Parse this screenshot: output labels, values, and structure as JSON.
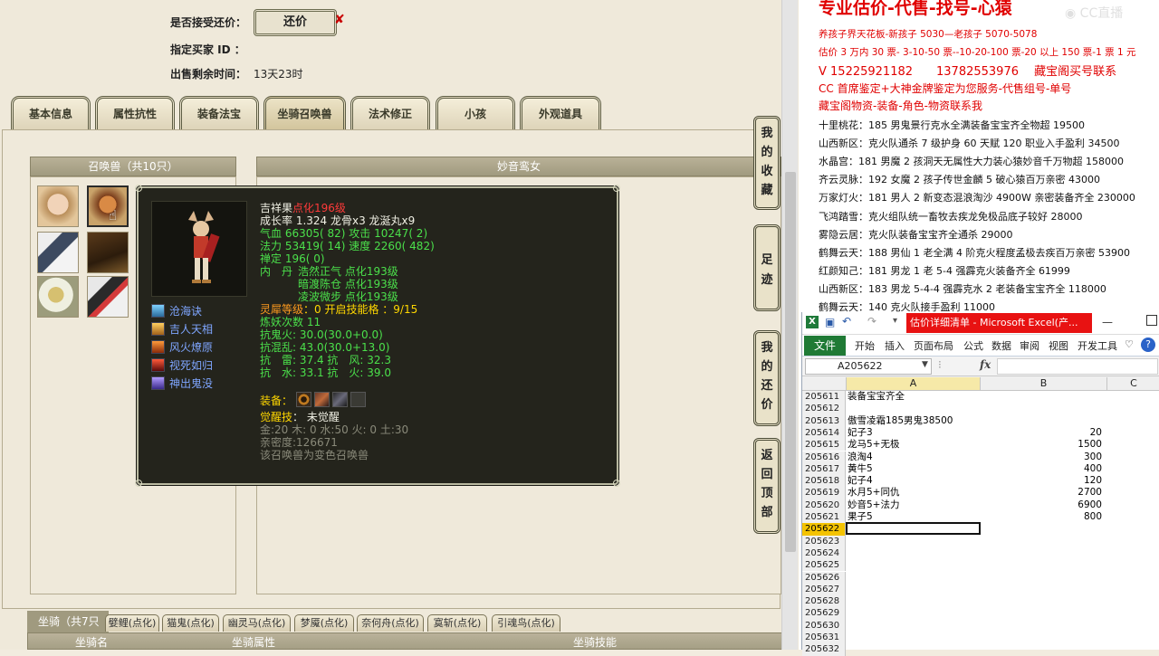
{
  "sale": {
    "accept_label": "是否接受还价：",
    "haggle_button": "还价",
    "buyer_label": "指定买家 ID ：",
    "time_label": "出售剩余时间：",
    "time_value": "13天23时"
  },
  "tabs": [
    "基本信息",
    "属性抗性",
    "装备法宝",
    "坐骑召唤兽",
    "法术修正",
    "小孩",
    "外观道具"
  ],
  "pets": {
    "header": "召唤兽（共10只）"
  },
  "pet_name_header": "妙音鸾女",
  "side_buttons": [
    "我的收藏",
    "足迹",
    "我的还价",
    "返回顶部"
  ],
  "tooltip": {
    "line1_name": "吉祥果",
    "line1_level": "点化196级",
    "line2": "成长率 1.324 龙骨x3 龙涎丸x9",
    "hp_label": "气血",
    "hp_val": "66305( 82)",
    "atk_label": "攻击",
    "atk_val": "10247( 2)",
    "mp_label": "法力",
    "mp_val": "53419( 14)",
    "spd_label": "速度",
    "spd_val": "2260( 482)",
    "zen": "禅定 196( 0)",
    "neidan_label": "内　丹",
    "neidan": [
      "浩然正气 点化193级",
      "暗渡陈仓 点化193级",
      "凌波微步 点化193级"
    ],
    "spirit_label": "灵犀等级",
    "spirit_value": "：0 开启技能格 ：9/15",
    "demon": "炼妖次数 11",
    "resist": [
      "抗鬼火: 30.0(30.0+0.0)",
      "抗混乱: 43.0(30.0+13.0)",
      "抗　雷: 37.4 抗　风: 32.3",
      "抗　水: 33.1 抗　火: 39.0"
    ],
    "equip_label": "装备：",
    "awaken_label": "觉醒技",
    "awaken_value": "： 未觉醒",
    "elements": "金:20 木: 0 水:50 火: 0 土:30",
    "intimacy": "亲密度:126671",
    "note": "该召唤兽为变色召唤兽",
    "skills": [
      "沧海诀",
      "吉人天相",
      "风火燎原",
      "视死如归",
      "神出鬼没"
    ]
  },
  "bottom": {
    "mount_header": "坐骑（共7只",
    "mount_tabs": [
      "嬖鲤(点化)",
      "猫鬼(点化)",
      "幽灵马(点化)",
      "梦魇(点化)",
      "奈何舟(点化)",
      "寞斩(点化)",
      "引魂鸟(点化)"
    ],
    "columns": [
      "坐骑名",
      "坐骑属性",
      "坐骑技能"
    ]
  },
  "ads": {
    "title": "专业估价-代售-找号-心猿",
    "line1": "养孩子界天花板-新孩子 5030—老孩子 5070-5078",
    "line2": "估价 3 万内 30 票- 3-10-50 票--10-20-100 票-20 以上 150 票-1 票 1 元",
    "line3": "V 15225921182　　13782553976　 藏宝阁买号联系",
    "line4": "CC 首席鉴定+大神金牌鉴定为您服务-代售组号-单号",
    "line5": "藏宝阁物资-装备-角色-物资联系我",
    "deals": [
      "十里桃花：185 男鬼景行克水全满装备宝宝齐全物超 19500",
      "山西新区：克火队通杀 7 级护身 60 天赋 120 职业入手盈利 34500",
      "水晶宫：181 男魔 2 孩洞天无属性大力装心猿妙音千万物超 158000",
      "齐云灵脉：192 女魔 2 孩子传世金麟 5 破心猿百万亲密 43000",
      "万家灯火：181 男人 2 新变态混浪淘沙 4900W 亲密装备齐全 230000",
      "飞鸿踏雪：克火组队统一畜牧去疾龙免极品底子较好 28000",
      "雾隐云居：克火队装备宝宝齐全通杀 29000",
      "鹤舞云天：188 男仙 1 老全满 4 阶克火程度孟极去疾百万亲密 53900",
      "红颜知己：181 男龙 1 老 5-4 强霹克火装备齐全 61999",
      "山西新区：183 男龙 5-4-4 强霹克水 2 老装备宝宝齐全 118000",
      "鹤舞云天：140 克火队接手盈利 11000"
    ]
  },
  "excel": {
    "doc_title": "估价详细清单 - Microsoft Excel(产...",
    "file_tab": "文件",
    "menu": [
      "开始",
      "插入",
      "页面布局",
      "公式",
      "数据",
      "审阅",
      "视图",
      "开发工具"
    ],
    "name_box": "A205622",
    "fx": "fx",
    "col_a": "A",
    "col_b": "B",
    "col_c": "C",
    "rows": [
      {
        "n": "205611",
        "a": "装备宝宝齐全",
        "b": ""
      },
      {
        "n": "205612",
        "a": "",
        "b": ""
      },
      {
        "n": "205613",
        "a": "傲雪凌霜185男鬼38500",
        "b": ""
      },
      {
        "n": "205614",
        "a": "妃子3",
        "b": "20"
      },
      {
        "n": "205615",
        "a": "龙马5+无极",
        "b": "1500"
      },
      {
        "n": "205616",
        "a": "浪淘4",
        "b": "300"
      },
      {
        "n": "205617",
        "a": "黄牛5",
        "b": "400"
      },
      {
        "n": "205618",
        "a": "妃子4",
        "b": "120"
      },
      {
        "n": "205619",
        "a": "水月5+同仇",
        "b": "2700"
      },
      {
        "n": "205620",
        "a": "妙音5+法力",
        "b": "6900"
      },
      {
        "n": "205621",
        "a": "果子5",
        "b": "800"
      },
      {
        "n": "205622",
        "a": "",
        "b": ""
      },
      {
        "n": "205623",
        "a": "",
        "b": ""
      },
      {
        "n": "205624",
        "a": "",
        "b": ""
      },
      {
        "n": "205625",
        "a": "",
        "b": ""
      },
      {
        "n": "205626",
        "a": "",
        "b": ""
      },
      {
        "n": "205627",
        "a": "",
        "b": ""
      },
      {
        "n": "205628",
        "a": "",
        "b": ""
      },
      {
        "n": "205629",
        "a": "",
        "b": ""
      },
      {
        "n": "205630",
        "a": "",
        "b": ""
      },
      {
        "n": "205631",
        "a": "",
        "b": ""
      },
      {
        "n": "205632",
        "a": "",
        "b": ""
      }
    ]
  }
}
